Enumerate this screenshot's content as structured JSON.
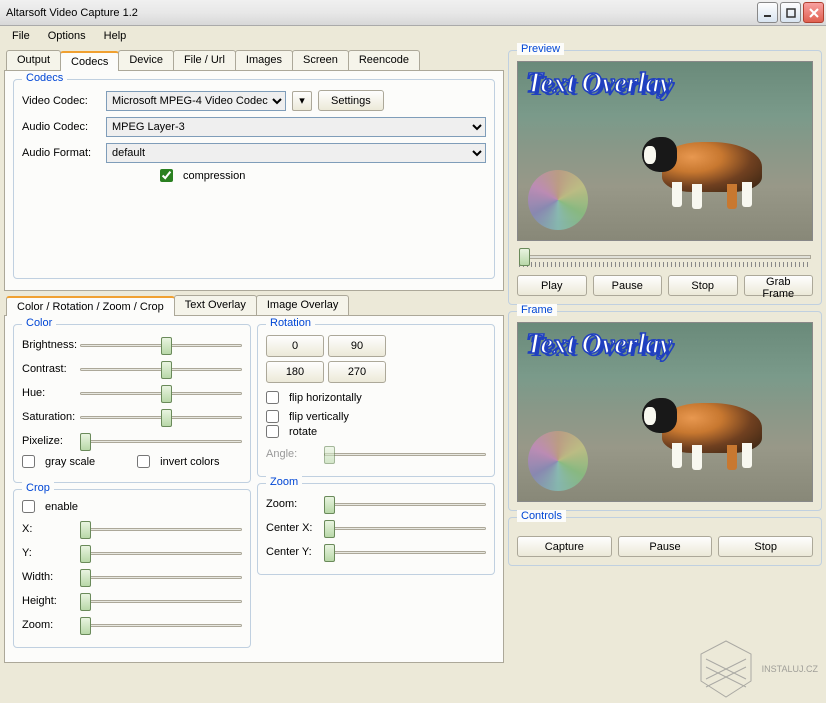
{
  "window": {
    "title": "Altarsoft Video Capture 1.2"
  },
  "menu": {
    "file": "File",
    "options": "Options",
    "help": "Help"
  },
  "tabs": {
    "output": "Output",
    "codecs": "Codecs",
    "device": "Device",
    "fileurl": "File / Url",
    "images": "Images",
    "screen": "Screen",
    "reencode": "Reencode"
  },
  "codecs": {
    "legend": "Codecs",
    "video_label": "Video Codec:",
    "video_value": "Microsoft MPEG-4 Video Codec",
    "audio_label": "Audio Codec:",
    "audio_value": "MPEG Layer-3",
    "format_label": "Audio Format:",
    "format_value": "default",
    "settings": "Settings",
    "compression": "compression"
  },
  "subtabs": {
    "color": "Color / Rotation / Zoom / Crop",
    "textoverlay": "Text Overlay",
    "imageoverlay": "Image Overlay"
  },
  "color": {
    "legend": "Color",
    "brightness": "Brightness:",
    "contrast": "Contrast:",
    "hue": "Hue:",
    "saturation": "Saturation:",
    "pixelize": "Pixelize:",
    "grayscale": "gray scale",
    "invert": "invert colors"
  },
  "rotation": {
    "legend": "Rotation",
    "b0": "0",
    "b90": "90",
    "b180": "180",
    "b270": "270",
    "fliph": "flip horizontally",
    "flipv": "flip vertically",
    "rotate": "rotate",
    "angle": "Angle:"
  },
  "crop": {
    "legend": "Crop",
    "enable": "enable",
    "x": "X:",
    "y": "Y:",
    "width": "Width:",
    "height": "Height:",
    "zoom": "Zoom:"
  },
  "zoom": {
    "legend": "Zoom",
    "zoom": "Zoom:",
    "cx": "Center X:",
    "cy": "Center Y:"
  },
  "preview": {
    "legend": "Preview",
    "overlay": "Text Overlay",
    "play": "Play",
    "pause": "Pause",
    "stop": "Stop",
    "grab": "Grab Frame"
  },
  "frame": {
    "legend": "Frame",
    "overlay": "Text Overlay"
  },
  "controls": {
    "legend": "Controls",
    "capture": "Capture",
    "pause": "Pause",
    "stop": "Stop"
  },
  "brand": "INSTALUJ.CZ"
}
